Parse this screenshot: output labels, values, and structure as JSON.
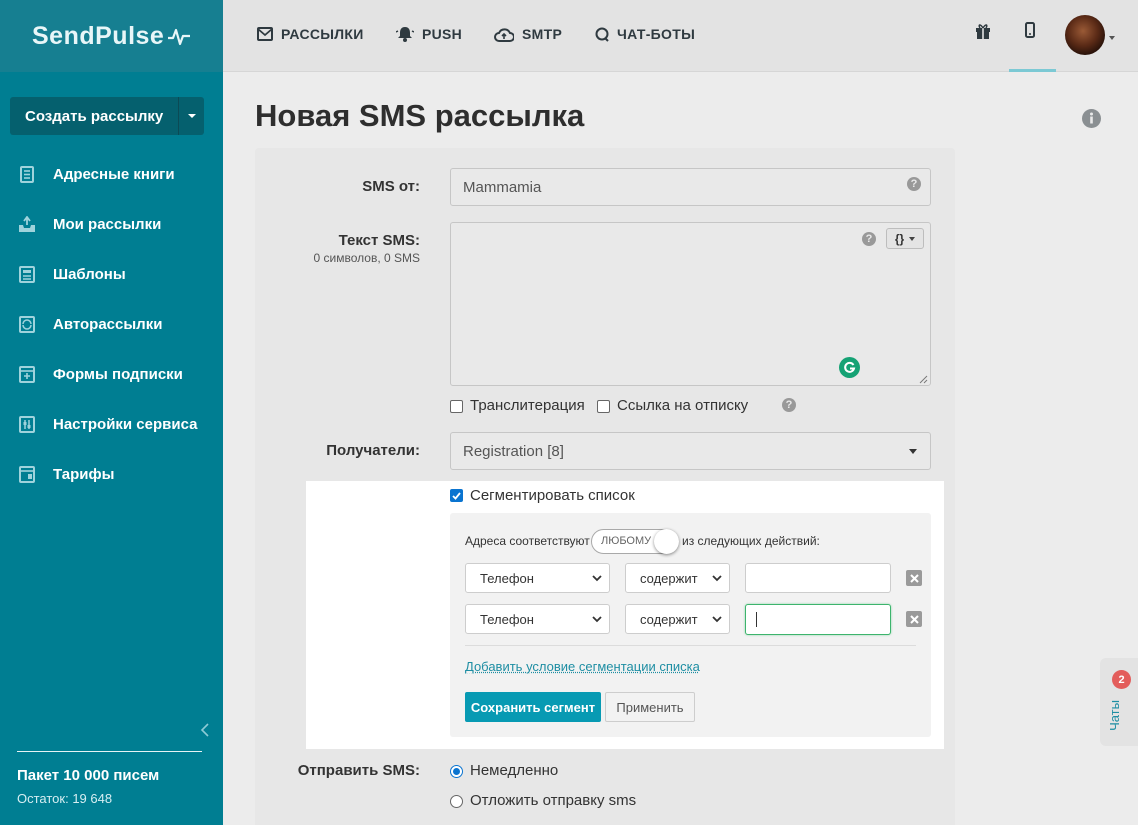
{
  "logo": "SendPulse",
  "sidebar": {
    "create_label": "Создать рассылку",
    "items": [
      {
        "label": "Адресные книги",
        "icon": "address-book-icon"
      },
      {
        "label": "Мои рассылки",
        "icon": "campaigns-icon"
      },
      {
        "label": "Шаблоны",
        "icon": "templates-icon"
      },
      {
        "label": "Авторассылки",
        "icon": "automation-icon"
      },
      {
        "label": "Формы подписки",
        "icon": "forms-icon"
      },
      {
        "label": "Настройки сервиса",
        "icon": "settings-icon"
      },
      {
        "label": "Тарифы",
        "icon": "pricing-icon"
      }
    ],
    "package": "Пакет 10 000 писем",
    "remaining": "Остаток: 19 648"
  },
  "topnav": {
    "items": [
      {
        "label": "РАССЫЛКИ",
        "icon": "envelope-icon"
      },
      {
        "label": "PUSH",
        "icon": "bell-icon"
      },
      {
        "label": "SMTP",
        "icon": "cloud-upload-icon"
      },
      {
        "label": "ЧАТ-БОТЫ",
        "icon": "chat-bubble-icon"
      }
    ]
  },
  "page": {
    "title": "Новая SMS рассылка"
  },
  "form": {
    "sender_label": "SMS от:",
    "sender_value": "Mammamia",
    "text_label": "Текст SMS:",
    "text_counter": "0 символов, 0 SMS",
    "var_button": "{}",
    "transliteration": "Транслитерация",
    "unsubscribe_link": "Ссылка на отписку",
    "recipients_label": "Получатели:",
    "recipients_value": "Registration [8]",
    "segment_checkbox": "Сегментировать список",
    "send_label": "Отправить SMS:",
    "send_now": "Немедленно",
    "send_later": "Отложить отправку sms"
  },
  "segment": {
    "match_prefix": "Адреса соответствуют",
    "match_toggle": "ЛЮБОМУ",
    "match_suffix": "из следующих действий:",
    "conditions": [
      {
        "field": "Телефон",
        "operator": "содержит",
        "value": ""
      },
      {
        "field": "Телефон",
        "operator": "содержит",
        "value": ""
      }
    ],
    "add_condition": "Добавить условие сегментации списка",
    "save_button": "Сохранить сегмент",
    "apply_button": "Применить"
  },
  "chat": {
    "label": "Чаты",
    "badge": "2"
  },
  "colors": {
    "sidebar": "#007e92",
    "primary_button": "#079ab3",
    "checkbox": "#0a74d0",
    "focus": "#3db46d",
    "badge": "#e35d5b"
  }
}
